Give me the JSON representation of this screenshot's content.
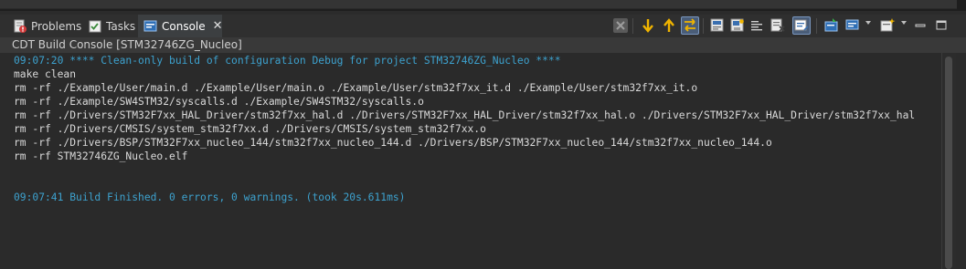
{
  "tabs": [
    {
      "label": "Problems",
      "icon": "problems-icon",
      "active": false
    },
    {
      "label": "Tasks",
      "icon": "tasks-icon",
      "active": false
    },
    {
      "label": "Console",
      "icon": "console-icon",
      "active": true
    }
  ],
  "toolbar": [
    "clear-console-icon",
    "scroll-lock-down-icon",
    "scroll-lock-up-icon",
    "word-wrap-icon",
    "copy-build-log-icon",
    "save-log-icon",
    "open-build-console-icon",
    "pin-console-icon",
    "display-selected-console-icon",
    "open-console-icon",
    "new-console-icon",
    "minimize-icon",
    "maximize-icon"
  ],
  "console": {
    "title": "CDT Build Console [STM32746ZG_Nucleo]",
    "lines": [
      {
        "text": "09:07:20 **** Clean-only build of configuration Debug for project STM32746ZG_Nucleo ****",
        "kind": "info"
      },
      {
        "text": "make clean",
        "kind": "text"
      },
      {
        "text": "rm -rf ./Example/User/main.d ./Example/User/main.o ./Example/User/stm32f7xx_it.d ./Example/User/stm32f7xx_it.o",
        "kind": "text"
      },
      {
        "text": "rm -rf ./Example/SW4STM32/syscalls.d ./Example/SW4STM32/syscalls.o",
        "kind": "text"
      },
      {
        "text": "rm -rf ./Drivers/STM32F7xx_HAL_Driver/stm32f7xx_hal.d ./Drivers/STM32F7xx_HAL_Driver/stm32f7xx_hal.o ./Drivers/STM32F7xx_HAL_Driver/stm32f7xx_hal",
        "kind": "text"
      },
      {
        "text": "rm -rf ./Drivers/CMSIS/system_stm32f7xx.d ./Drivers/CMSIS/system_stm32f7xx.o",
        "kind": "text"
      },
      {
        "text": "rm -rf ./Drivers/BSP/STM32F7xx_nucleo_144/stm32f7xx_nucleo_144.d ./Drivers/BSP/STM32F7xx_nucleo_144/stm32f7xx_nucleo_144.o",
        "kind": "text"
      },
      {
        "text": "rm -rf STM32746ZG_Nucleo.elf",
        "kind": "text"
      },
      {
        "text": "",
        "kind": "text"
      },
      {
        "text": "",
        "kind": "text"
      },
      {
        "text": "09:07:41 Build Finished. 0 errors, 0 warnings. (took 20s.611ms)",
        "kind": "info"
      }
    ]
  },
  "colors": {
    "info_text": "#3da2cf",
    "normal_text": "#dadada",
    "background": "#2a2a2a"
  }
}
